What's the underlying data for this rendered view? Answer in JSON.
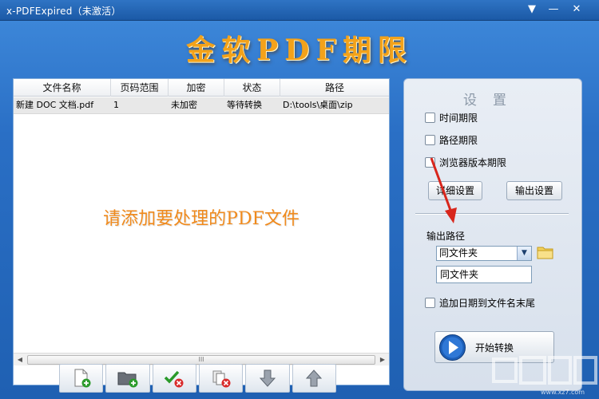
{
  "window": {
    "title": "x-PDFExpired（未激活）",
    "menu_glyph": "▼",
    "min_glyph": "—",
    "close_glyph": "✕"
  },
  "brand": {
    "title": "金软PDF期限"
  },
  "file_list": {
    "columns": [
      "文件名称",
      "页码范围",
      "加密",
      "状态",
      "路径"
    ],
    "rows": [
      {
        "name": "新建 DOC 文档.pdf",
        "pages": "1",
        "encrypt": "未加密",
        "status": "等待转换",
        "path": "D:\\tools\\桌面\\zip"
      }
    ],
    "empty_prompt": "请添加要处理的PDF文件",
    "scroll_thumb_mark": "III"
  },
  "toolbar": {
    "buttons": [
      {
        "name": "add-file",
        "icon": "file-add-icon"
      },
      {
        "name": "add-folder",
        "icon": "folder-add-icon"
      },
      {
        "name": "clear-all",
        "icon": "check-remove-icon"
      },
      {
        "name": "remove-selected",
        "icon": "files-remove-icon"
      },
      {
        "name": "move-down",
        "icon": "arrow-down-icon"
      },
      {
        "name": "move-up",
        "icon": "arrow-up-icon"
      }
    ]
  },
  "settings": {
    "title": "设置",
    "options": [
      {
        "label": "时间期限",
        "checked": false
      },
      {
        "label": "路径期限",
        "checked": false
      },
      {
        "label": "浏览器版本期限",
        "checked": false
      }
    ],
    "detail_button": "详细设置",
    "output_button": "输出设置",
    "output_path_label": "输出路径",
    "output_select_value": "同文件夹",
    "output_path_value": "同文件夹",
    "append_date_label": "追加日期到文件名末尾",
    "append_date_checked": false,
    "start_button": "开始转换"
  },
  "watermark": {
    "text": "www.xz7.com"
  },
  "colors": {
    "brand_orange": "#f3a21a",
    "prompt_orange": "#f08a1c",
    "window_blue": "#1f63b4",
    "annotation_red": "#d8261c"
  }
}
